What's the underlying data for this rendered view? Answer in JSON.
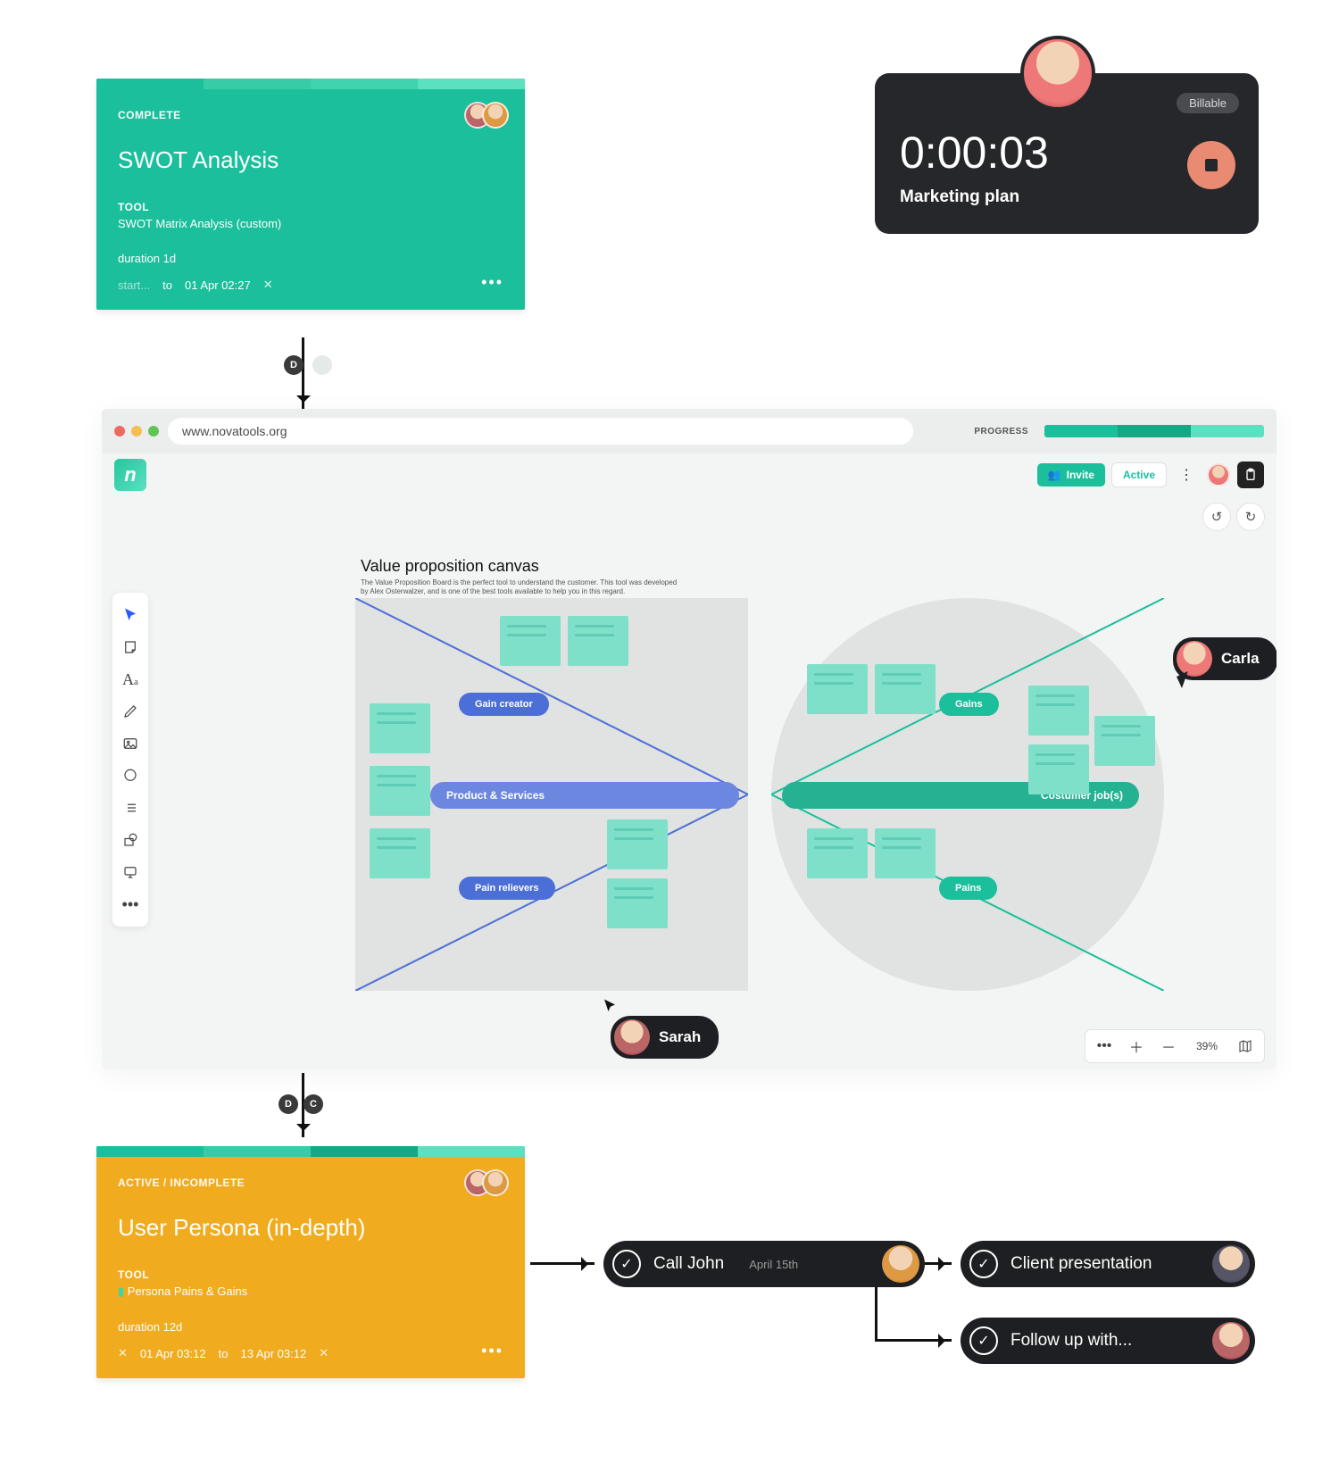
{
  "swot_card": {
    "status": "COMPLETE",
    "title": "SWOT Analysis",
    "tool_label": "TOOL",
    "tool_name": "SWOT Matrix Analysis (custom)",
    "duration": "duration 1d",
    "start_hint": "start...",
    "to": "to",
    "end": "01 Apr 02:27"
  },
  "persona_card": {
    "status": "ACTIVE / INCOMPLETE",
    "title": "User Persona (in-depth)",
    "tool_label": "TOOL",
    "tool_name": "Persona Pains & Gains",
    "duration": "duration 12d",
    "start": "01 Apr 03:12",
    "to": "to",
    "end": "13 Apr 03:12"
  },
  "timer": {
    "billable": "Billable",
    "time": "0:00:03",
    "task": "Marketing plan"
  },
  "browser": {
    "url": "www.novatools.org",
    "progress_label": "PROGRESS",
    "invite": "Invite",
    "active": "Active",
    "logo": "n"
  },
  "canvas": {
    "title": "Value proposition canvas",
    "subtitle": "The Value Proposition Board is the perfect tool to understand the customer. This tool was developed by Alex Osterwalzer, and is one of the best tools available to help you in this regard.",
    "gain_creator": "Gain creator",
    "product_services": "Product & Services",
    "pain_relievers": "Pain relievers",
    "gains": "Gains",
    "customer_jobs": "Costumer job(s)",
    "pains": "Pains",
    "zoom": "39%",
    "help": "help"
  },
  "users": {
    "carla": "Carla",
    "sarah": "Sarah"
  },
  "nodes": {
    "d": "D",
    "c": "C"
  },
  "tasks": {
    "call": "Call John",
    "call_date": "April 15th",
    "presentation": "Client presentation",
    "followup": "Follow up with..."
  }
}
